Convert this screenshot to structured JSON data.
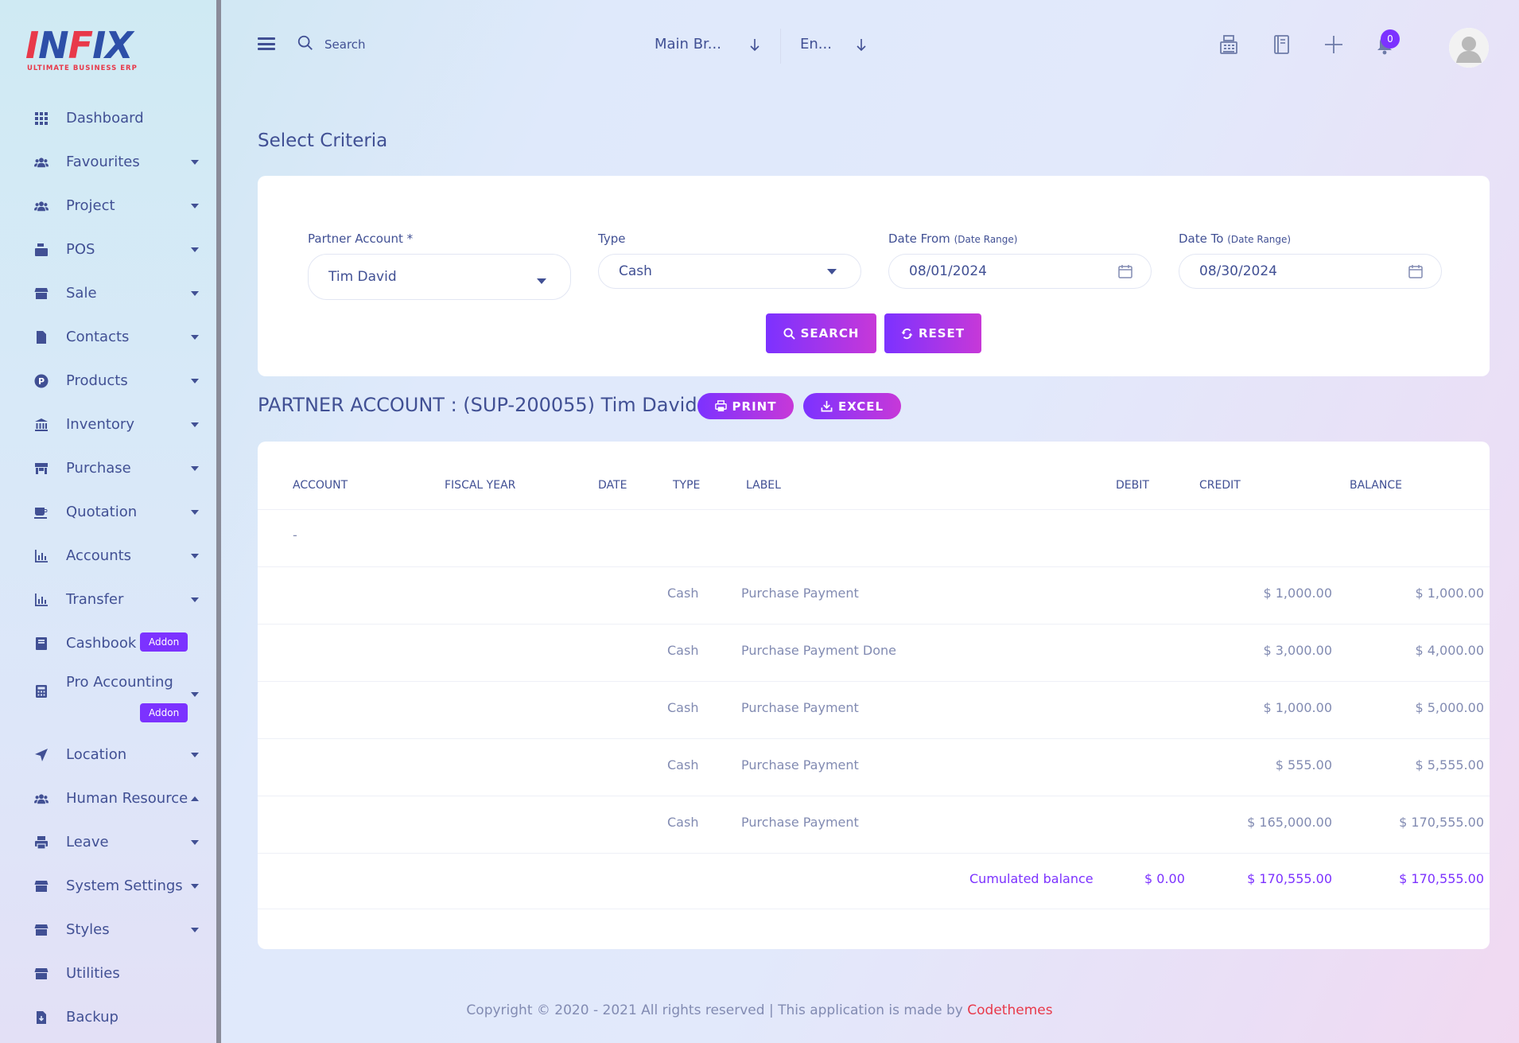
{
  "brand": {
    "logo_main": "INFIX",
    "logo_sub": "ULTIMATE BUSINESS ERP",
    "red": "#e8394a",
    "blue": "#2d4fa8"
  },
  "colors": {
    "accent": "#7c32ff",
    "accent_end": "#c738d8",
    "text": "#415094",
    "muted": "#828bb2"
  },
  "sidebar": {
    "items": [
      {
        "label": "Dashboard",
        "icon": "grid-icon",
        "caret": "none"
      },
      {
        "label": "Favourites",
        "icon": "users-icon",
        "caret": "down"
      },
      {
        "label": "Project",
        "icon": "users-icon",
        "caret": "down"
      },
      {
        "label": "POS",
        "icon": "cash-register-icon",
        "caret": "down"
      },
      {
        "label": "Sale",
        "icon": "store-icon",
        "caret": "down"
      },
      {
        "label": "Contacts",
        "icon": "document-icon",
        "caret": "down"
      },
      {
        "label": "Products",
        "icon": "product-p-icon",
        "caret": "down"
      },
      {
        "label": "Inventory",
        "icon": "bank-icon",
        "caret": "down"
      },
      {
        "label": "Purchase",
        "icon": "shop-icon",
        "caret": "down"
      },
      {
        "label": "Quotation",
        "icon": "cup-icon",
        "caret": "down"
      },
      {
        "label": "Accounts",
        "icon": "bar-chart-icon",
        "caret": "down"
      },
      {
        "label": "Transfer",
        "icon": "bar-chart-icon",
        "caret": "down"
      },
      {
        "label": "Cashbook",
        "icon": "book-icon",
        "caret": "none",
        "badge": "Addon"
      },
      {
        "label": "Pro Accounting",
        "icon": "calculator-icon",
        "caret": "down",
        "badge": "Addon"
      },
      {
        "label": "Location",
        "icon": "location-arrow-icon",
        "caret": "down"
      },
      {
        "label": "Human Resource",
        "icon": "users-icon",
        "caret": "up"
      },
      {
        "label": "Leave",
        "icon": "printer-icon",
        "caret": "down"
      },
      {
        "label": "System Settings",
        "icon": "store-icon",
        "caret": "down"
      },
      {
        "label": "Styles",
        "icon": "store-icon",
        "caret": "down"
      },
      {
        "label": "Utilities",
        "icon": "store-icon",
        "caret": "none"
      },
      {
        "label": "Backup",
        "icon": "file-download-icon",
        "caret": "none"
      }
    ]
  },
  "header": {
    "search_placeholder": "Search",
    "branch_select": "Main Br...",
    "language_select": "En...",
    "notification_count": "0"
  },
  "criteria": {
    "title": "Select Criteria",
    "partner_label": "Partner Account *",
    "partner_value": "Tim David",
    "type_label": "Type",
    "type_value": "Cash",
    "date_from_label": "Date From",
    "date_from_hint": "(Date Range)",
    "date_from_value": "08/01/2024",
    "date_to_label": "Date To",
    "date_to_hint": "(Date Range)",
    "date_to_value": "08/30/2024",
    "search_button": "SEARCH",
    "reset_button": "RESET"
  },
  "report": {
    "title": "PARTNER ACCOUNT : (SUP-200055) Tim David",
    "print_button": "PRINT",
    "excel_button": "EXCEL",
    "columns": [
      "ACCOUNT",
      "FISCAL YEAR",
      "DATE",
      "TYPE",
      "LABEL",
      "DEBIT",
      "CREDIT",
      "BALANCE"
    ],
    "account_cell": "-",
    "rows": [
      {
        "type": "Cash",
        "label": "Purchase Payment",
        "credit": "$ 1,000.00",
        "balance": "$ 1,000.00"
      },
      {
        "type": "Cash",
        "label": "Purchase Payment Done",
        "credit": "$ 3,000.00",
        "balance": "$ 4,000.00"
      },
      {
        "type": "Cash",
        "label": "Purchase Payment",
        "credit": "$ 1,000.00",
        "balance": "$ 5,000.00"
      },
      {
        "type": "Cash",
        "label": "Purchase Payment",
        "credit": "$ 555.00",
        "balance": "$ 5,555.00"
      },
      {
        "type": "Cash",
        "label": "Purchase Payment",
        "credit": "$ 165,000.00",
        "balance": "$ 170,555.00"
      }
    ],
    "total": {
      "label": "Cumulated balance",
      "debit": "$ 0.00",
      "credit": "$ 170,555.00",
      "balance": "$ 170,555.00"
    }
  },
  "footer": {
    "text": "Copyright © 2020 - 2021 All rights reserved | This application is made by ",
    "link": "Codethemes"
  }
}
